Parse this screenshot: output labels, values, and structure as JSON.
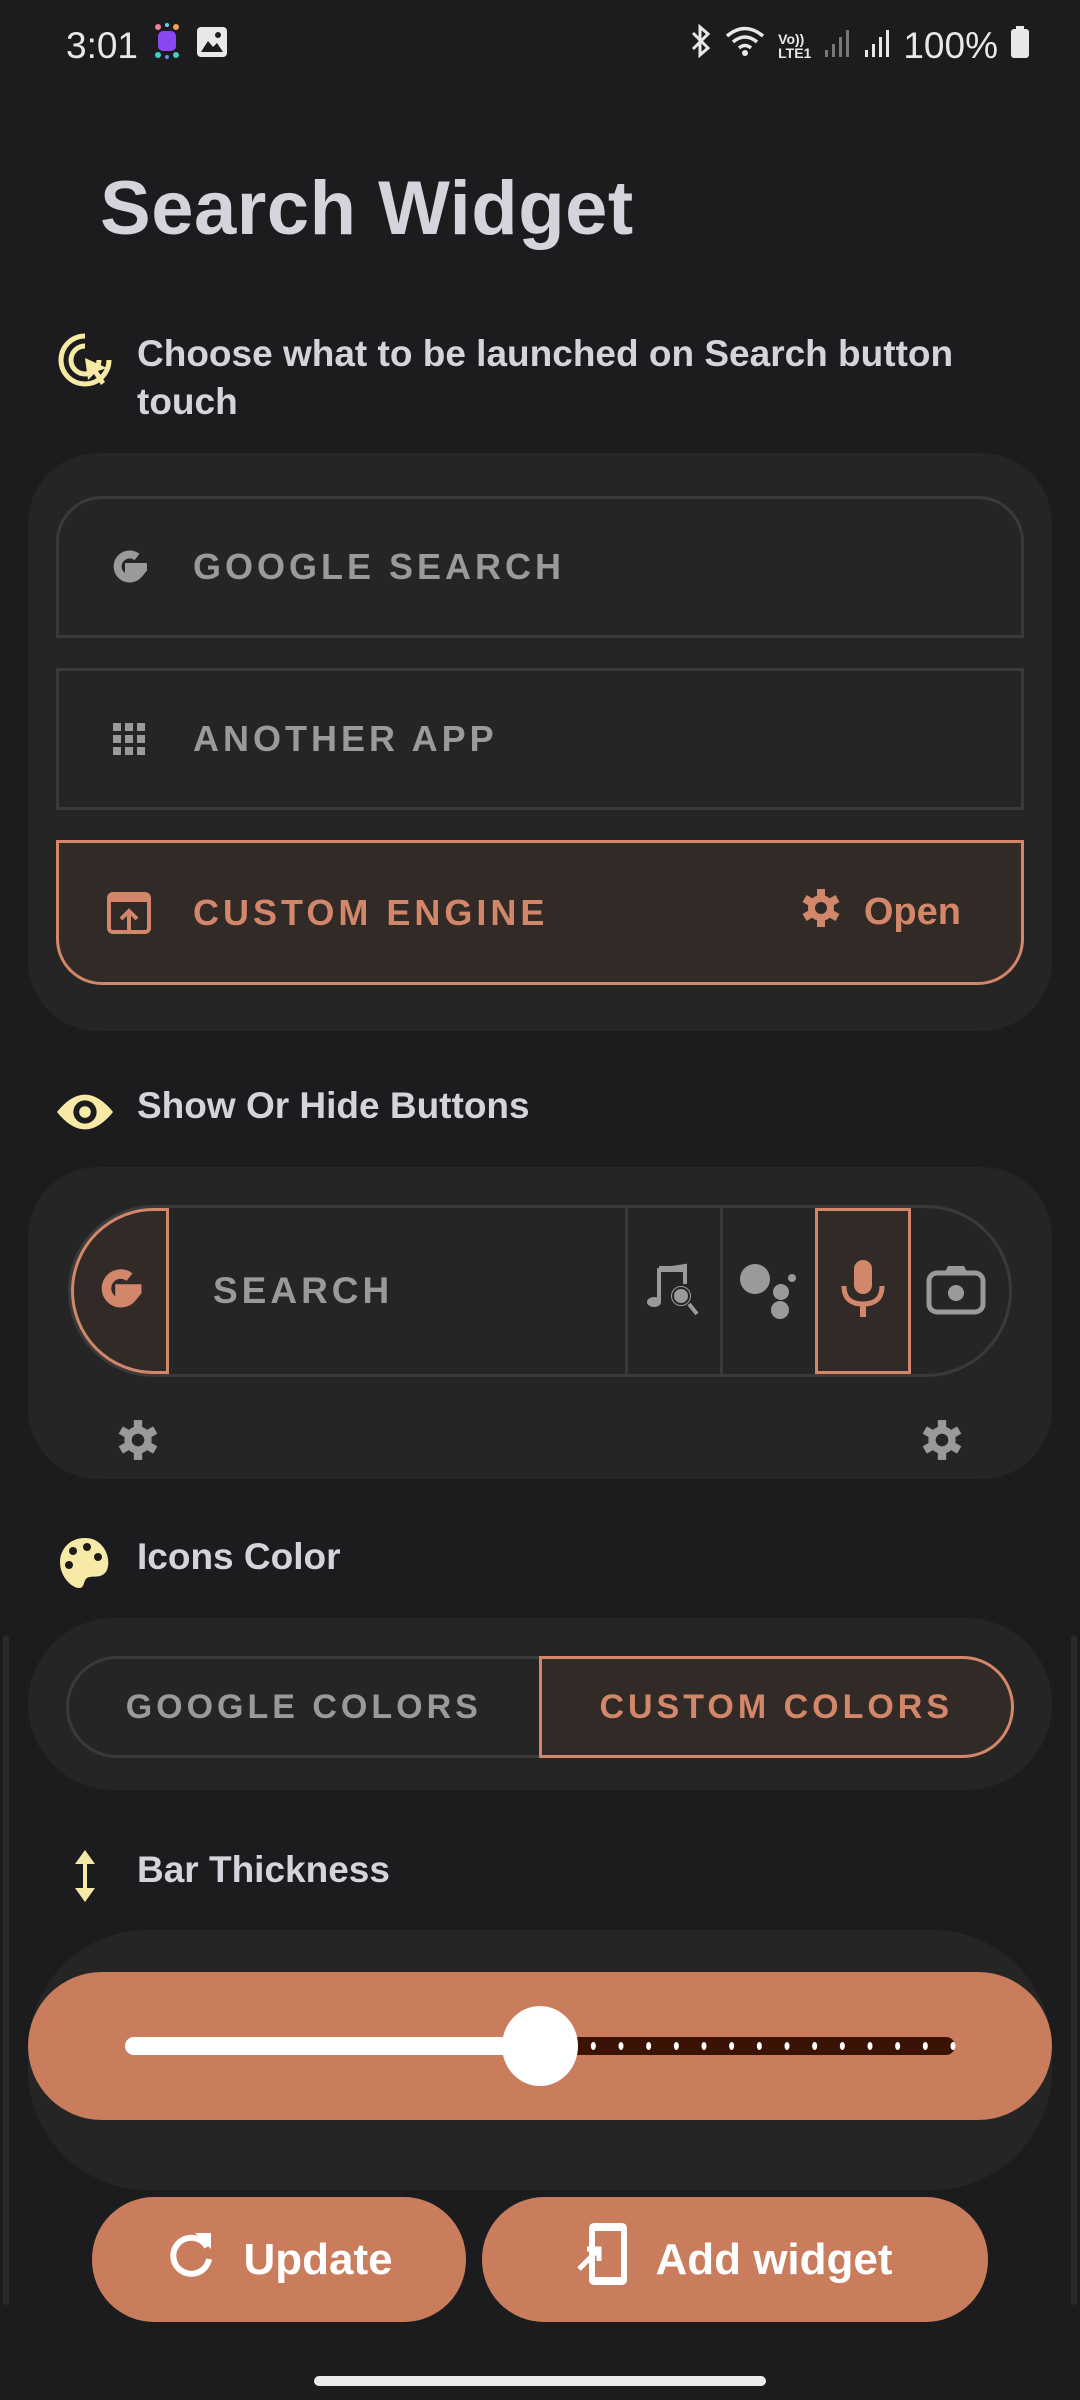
{
  "status_bar": {
    "time": "3:01",
    "notification_icons": [
      "app-notification-icon",
      "gallery-icon"
    ],
    "system_icons": [
      "bluetooth-icon",
      "wifi-icon",
      "volte-lte1-icon",
      "signal-icon-sim1",
      "signal-icon-sim2",
      "battery-icon"
    ],
    "volte_label_top": "Vo))",
    "volte_label_bottom": "LTE1",
    "battery": "100%"
  },
  "page": {
    "title": "Search Widget"
  },
  "launch_section": {
    "heading": "Choose what to be launched on Search button touch",
    "icon": "touch-target-icon",
    "options": [
      {
        "label": "GOOGLE SEARCH",
        "icon": "google-g-icon",
        "selected": false
      },
      {
        "label": "ANOTHER APP",
        "icon": "apps-grid-icon",
        "selected": false
      },
      {
        "label": "CUSTOM ENGINE",
        "icon": "open-in-browser-icon",
        "selected": true,
        "action_label": "Open",
        "action_icon": "gear-icon"
      }
    ]
  },
  "buttons_section": {
    "heading": "Show Or Hide Buttons",
    "icon": "eye-icon",
    "preview": {
      "search_label": "SEARCH",
      "buttons": [
        {
          "name": "google-logo",
          "visible": true
        },
        {
          "name": "sound-search",
          "visible": false
        },
        {
          "name": "google-assistant",
          "visible": false
        },
        {
          "name": "voice-search",
          "visible": true
        },
        {
          "name": "google-lens",
          "visible": false
        }
      ]
    },
    "left_settings_icon": "gear-icon",
    "right_settings_icon": "gear-icon"
  },
  "icons_color_section": {
    "heading": "Icons Color",
    "icon": "palette-icon",
    "options": [
      "GOOGLE COLORS",
      "CUSTOM COLORS"
    ],
    "selected": "CUSTOM COLORS"
  },
  "thickness_section": {
    "heading": "Bar Thickness",
    "icon": "vertical-resize-icon",
    "slider": {
      "value_fraction": 0.5,
      "steps": 30,
      "current_step": 15
    }
  },
  "actions": {
    "update_label": "Update",
    "add_widget_label": "Add widget"
  },
  "colors": {
    "accent": "#c97d5c",
    "accent_text": "#d3876a",
    "header_icon": "#f7e9a6",
    "background": "#1c1c1e",
    "card": "#252525"
  }
}
